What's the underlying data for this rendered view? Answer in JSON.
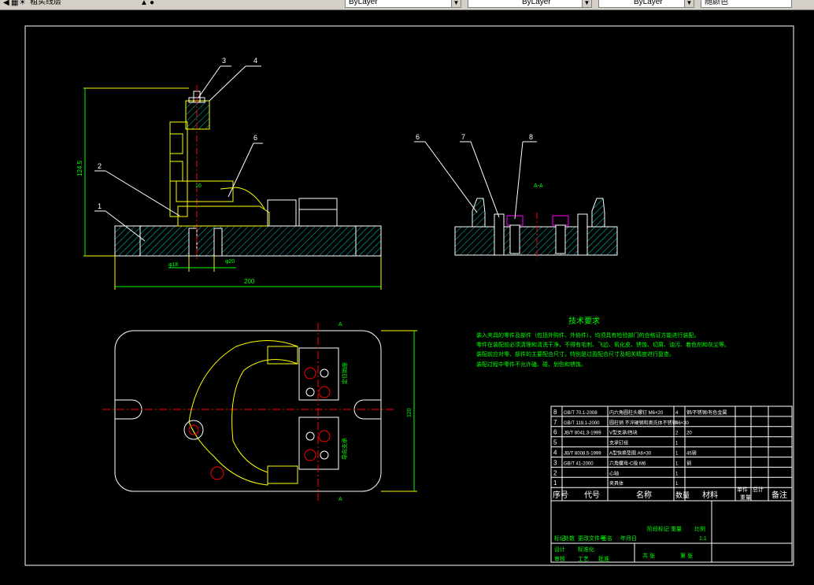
{
  "toolbar": {
    "layer_name": "粗实线层",
    "color": "ByLayer",
    "linetype": "ByLayer",
    "lineweight": "ByLayer",
    "plotstyle": "随颜色"
  },
  "drawing": {
    "part_labels": [
      "1",
      "2",
      "3",
      "4",
      "5",
      "6",
      "7",
      "8"
    ],
    "dims": {
      "height": "124.5",
      "width": "200",
      "depth": "120",
      "d1": "φ18",
      "d2": "φ20",
      "d3": "10"
    },
    "section_mark": "A",
    "section_label": "A-A",
    "tech_title": "技术要求",
    "tech_lines": [
      "装入夹具的零件及部件（包括外购件、外协件），均须具有检验部门的合格证方能进行装配。",
      "零件在装配前必须清理和清洗干净，不得有毛刺、飞边、氧化皮、锈蚀、切屑、油污、着色剂和灰尘等。",
      "装配前应对零、部件的主要配合尺寸，特别是过盈配合尺寸及相关精度进行复查。",
      "装配过程中零件不允许磕、碰、划伤和锈蚀。"
    ],
    "side_label_a": "定位销座",
    "side_label_b": "导向支承"
  },
  "bom": {
    "rows": [
      {
        "no": "8",
        "code": "GB/T 70.1-2008",
        "name": "内六角圆柱头螺钉 M6×20",
        "qty": "4",
        "material": "钢/不锈钢/有色金属"
      },
      {
        "no": "7",
        "code": "GB/T 119.1-2000",
        "name": "圆柱销 不淬硬钢和奥氏体不锈钢 6×30",
        "qty": "4",
        "material": ""
      },
      {
        "no": "6",
        "code": "JB/T 8041.3-1999",
        "name": "V型支承/挡块",
        "qty": "2",
        "material": "20"
      },
      {
        "no": "5",
        "code": "",
        "name": "支承钉组",
        "qty": "1",
        "material": ""
      },
      {
        "no": "4",
        "code": "JB/T 8008.5-1999",
        "name": "A型快换垫圈 A6×30",
        "qty": "1",
        "material": "45钢"
      },
      {
        "no": "3",
        "code": "GB/T 41-2000",
        "name": "六角螺母-C级 M6",
        "qty": "1",
        "material": "钢"
      },
      {
        "no": "2",
        "code": "",
        "name": "心轴",
        "qty": "1",
        "material": ""
      },
      {
        "no": "1",
        "code": "",
        "name": "夹具体",
        "qty": "1",
        "material": ""
      }
    ],
    "header": {
      "no": "序号",
      "code": "代号",
      "name": "名称",
      "qty": "数量",
      "material": "材料",
      "unit": "单件",
      "total": "总计",
      "weight": "重量",
      "remark": "备注"
    },
    "title_block": {
      "mark": "标记",
      "count": "处数",
      "zone": "分区",
      "change_doc": "更改文件号",
      "sign": "签名",
      "date": "年月日",
      "stage": "阶段标记",
      "weight": "重量",
      "scale": "比例",
      "scale_value": "1:1",
      "design": "设计",
      "std": "标准化",
      "review": "审核",
      "process": "工艺",
      "approve": "批准",
      "sheets": "共 张",
      "sheet": "第 张"
    }
  },
  "colors": {
    "border": "#ffffff",
    "yellow": "#ffff00",
    "green": "#00ff00",
    "hatch": "#00c8c8",
    "red": "#ff0000",
    "magenta": "#ff00ff",
    "outline": "#ffffff"
  }
}
